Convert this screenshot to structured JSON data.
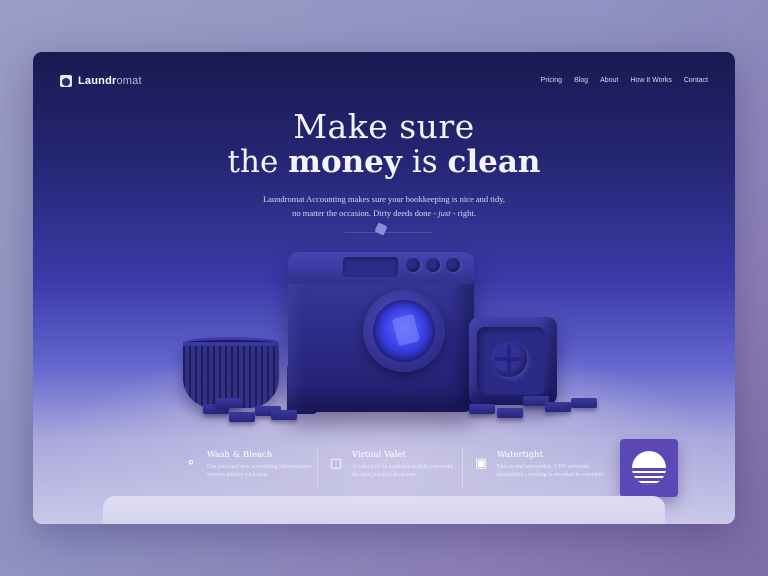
{
  "brand": {
    "name_main": "Laundr",
    "name_accent": "omat"
  },
  "nav": {
    "items": [
      "Pricing",
      "Blog",
      "About",
      "How It Works",
      "Contact"
    ]
  },
  "hero": {
    "line1": "Make sure",
    "line2_the": "the ",
    "line2_money": "money",
    "line2_is": " is ",
    "line2_clean": "clean",
    "subtitle_line1": "Laundromat Accounting makes sure your bookkeeping is nice and tidy,",
    "subtitle_line2_a": "no matter the occasion. Dirty deeds done - ",
    "subtitle_line2_italic": "just",
    "subtitle_line2_b": " - right."
  },
  "features": [
    {
      "icon": "bubbles-icon",
      "title": "Wash & Bleach",
      "desc": "Our tried and true accounting infrastructure ensures quality each time"
    },
    {
      "icon": "cash-icon",
      "title": "Virtual Valet",
      "desc": "A valet will be available to help you make the best possible decisions"
    },
    {
      "icon": "lock-icon",
      "title": "Watertight",
      "desc": "End-to-end encryption, VPN networks, blockchain - nothing is revealed to outsiders"
    }
  ],
  "colors": {
    "accent": "#5b47b6",
    "bg_top": "#191a52",
    "bg_mid": "#3a3aa8"
  }
}
